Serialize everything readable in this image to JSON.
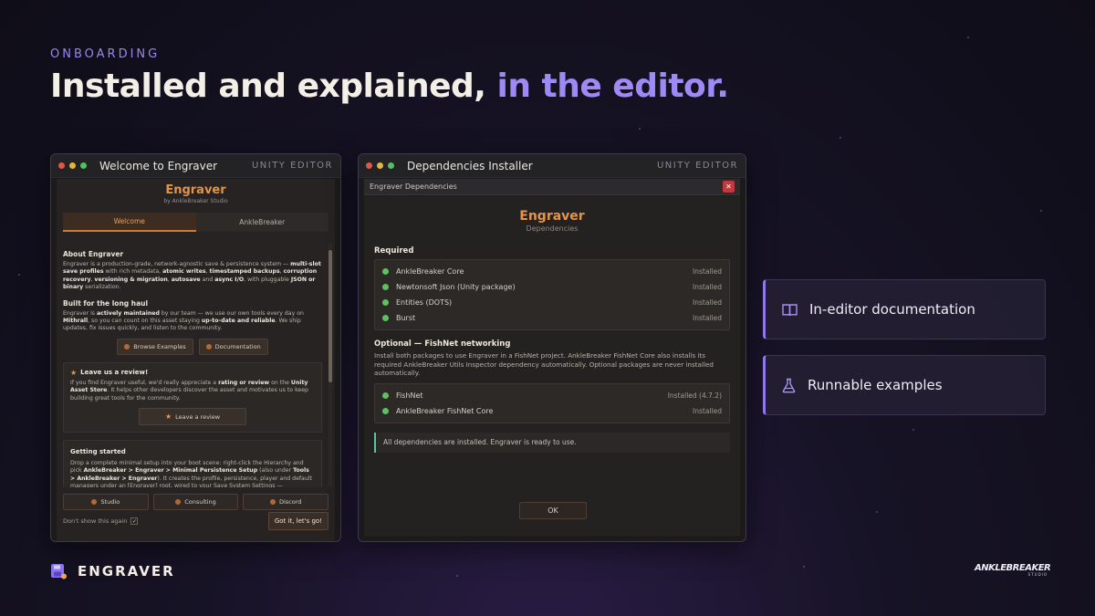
{
  "slide": {
    "eyebrow": "ONBOARDING",
    "headline_main": "Installed and explained,",
    "headline_accent": "in the editor.",
    "accent_color": "#9f89f5"
  },
  "window_welcome": {
    "title": "Welcome to Engraver",
    "tag": "UNITY EDITOR",
    "brand_name": "Engraver",
    "brand_by": "by AnkleBreaker Studio",
    "tabs": [
      {
        "label": "Welcome",
        "active": true
      },
      {
        "label": "AnkleBreaker",
        "active": false
      }
    ],
    "about": {
      "heading": "About Engraver",
      "text_parts": [
        "Engraver is a production-grade, network-agnostic save & persistence system — ",
        "multi-slot save profiles",
        " with rich metadata, ",
        "atomic writes",
        ", ",
        "timestamped backups",
        ", ",
        "corruption recovery",
        ", ",
        "versioning & migration",
        ", ",
        "autosave",
        " and ",
        "async I/O",
        ", with pluggable ",
        "JSON or binary",
        " serialization."
      ]
    },
    "long_haul": {
      "heading": "Built for the long haul",
      "text_parts": [
        "Engraver is ",
        "actively maintained",
        " by our team — we use our own tools every day on ",
        "Mithrall",
        ", so you can count on this asset staying ",
        "up-to-date and reliable",
        ". We ship updates, fix issues quickly, and listen to the community."
      ]
    },
    "buttons": [
      "Browse Examples",
      "Documentation"
    ],
    "review": {
      "heading": "Leave us a review!",
      "text_parts": [
        "If you find Engraver useful, we'd really appreciate a ",
        "rating or review",
        " on the ",
        "Unity Asset Store",
        ". It helps other developers discover the asset and motivates us to keep building great tools for the community."
      ],
      "button": "Leave a review"
    },
    "getting_started": {
      "heading": "Getting started",
      "text_parts": [
        "Drop a complete minimal setup into your boot scene: right-click the Hierarchy and pick ",
        "AnkleBreaker > Engraver > Minimal Persistence Setup",
        " (also under ",
        "Tools > AnkleBreaker > Engraver",
        "). It creates the profile, persistence, player and default managers under an [Engraver] root, wired to your Save System Settings — idempotent and undoable."
      ]
    },
    "footer_buttons": [
      "Studio",
      "Consulting",
      "Discord"
    ],
    "dont_show": "Don't show this again",
    "dont_show_checked": true,
    "got_it": "Got it, let's go!"
  },
  "window_deps": {
    "title": "Dependencies Installer",
    "tag": "UNITY EDITOR",
    "subwindow_title": "Engraver Dependencies",
    "brand_name": "Engraver",
    "brand_sub": "Dependencies",
    "required_heading": "Required",
    "required": [
      {
        "name": "AnkleBreaker Core",
        "status": "Installed"
      },
      {
        "name": "Newtonsoft Json (Unity package)",
        "status": "Installed"
      },
      {
        "name": "Entities (DOTS)",
        "status": "Installed"
      },
      {
        "name": "Burst",
        "status": "Installed"
      }
    ],
    "optional_heading": "Optional — FishNet networking",
    "optional_text": "Install both packages to use Engraver in a FishNet project. AnkleBreaker FishNet Core also installs its required AnkleBreaker Utils Inspector dependency automatically. Optional packages are never installed automatically.",
    "optional": [
      {
        "name": "FishNet",
        "status": "Installed (4.7.2)"
      },
      {
        "name": "AnkleBreaker FishNet Core",
        "status": "Installed"
      }
    ],
    "success_message": "All dependencies are installed. Engraver is ready to use.",
    "ok_button": "OK"
  },
  "features": [
    {
      "label": "In-editor documentation",
      "icon": "book-icon"
    },
    {
      "label": "Runnable examples",
      "icon": "flask-icon"
    }
  ],
  "footer": {
    "product": "ENGRAVER",
    "studio_logo_text": "ANKLEBREAKER",
    "studio_logo_sub": "STUDIO"
  }
}
